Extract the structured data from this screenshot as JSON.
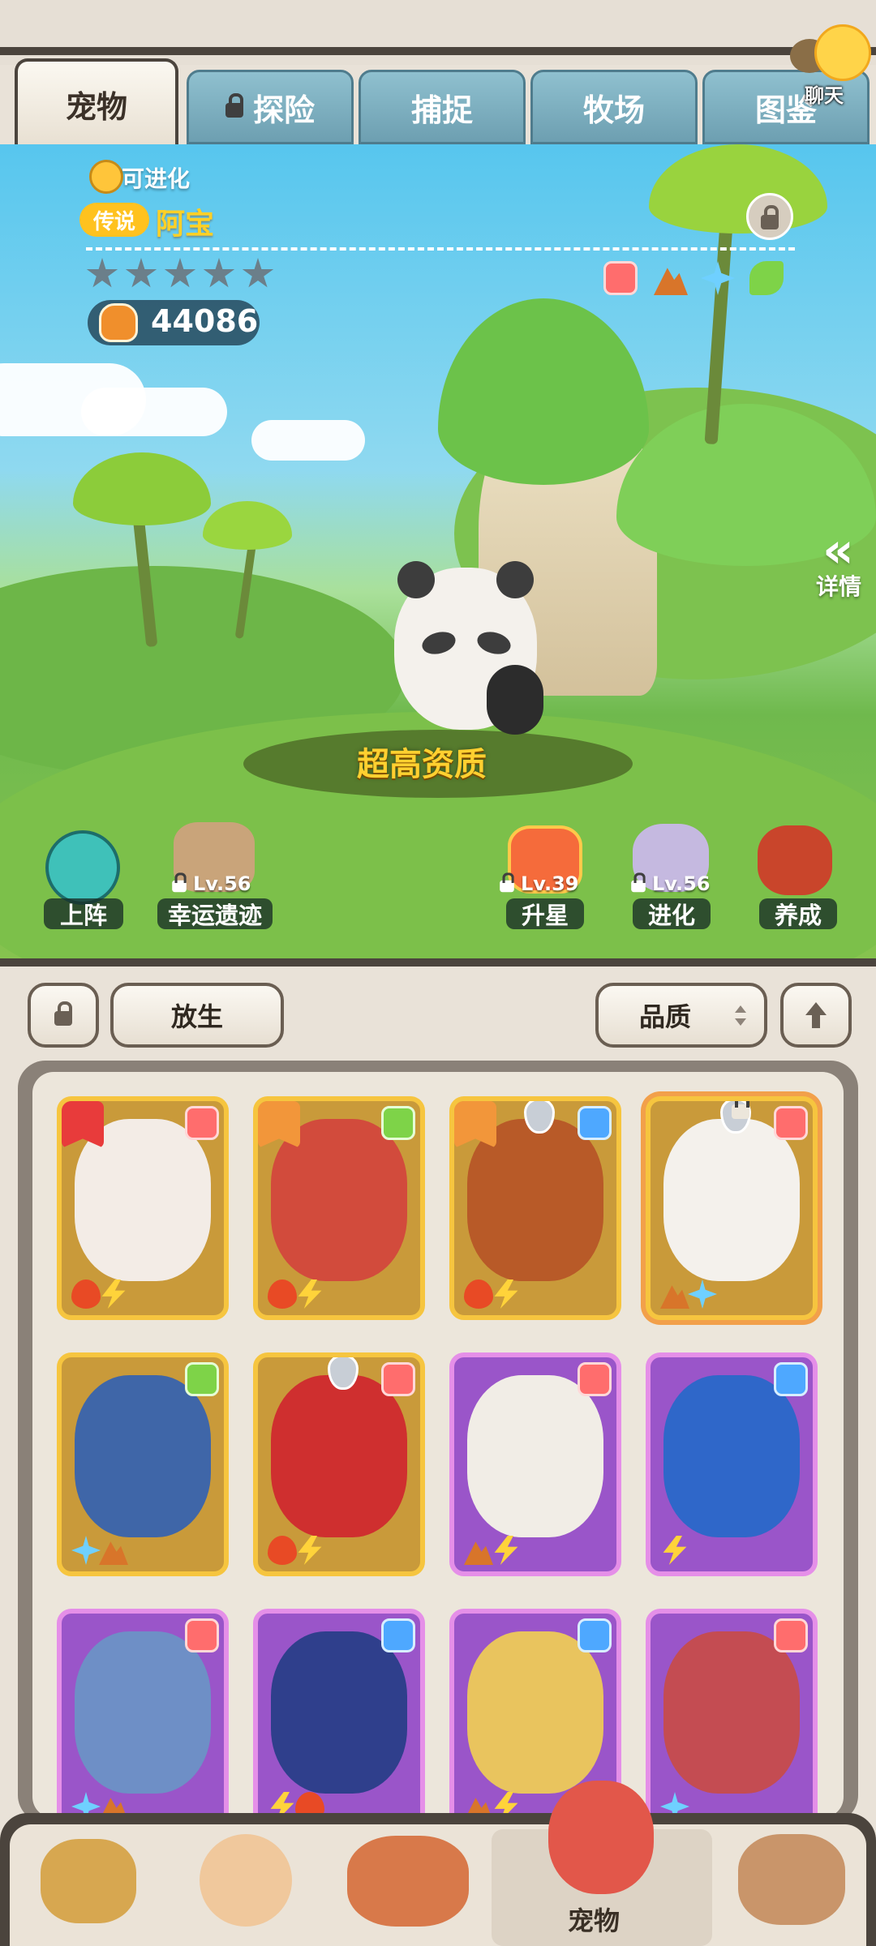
{
  "tabs": [
    {
      "label": "宠物",
      "active": true,
      "locked": false
    },
    {
      "label": "探险",
      "active": false,
      "locked": true
    },
    {
      "label": "捕捉",
      "active": false,
      "locked": false
    },
    {
      "label": "牧场",
      "active": false,
      "locked": false
    },
    {
      "label": "图鉴",
      "active": false,
      "locked": false
    }
  ],
  "chat": {
    "label": "聊天"
  },
  "pet": {
    "evolvable_text": "可进化",
    "rarity": "传说",
    "name": "阿宝",
    "stars_total": 5,
    "stars_filled": 0,
    "power": "44086",
    "quality_text": "超高资质",
    "traits": [
      "paw-red-icon",
      "earth-icon",
      "ice-icon",
      "leaf-icon"
    ]
  },
  "detail": {
    "arrow": "«",
    "label": "详情"
  },
  "actions": [
    {
      "label": "上阵",
      "level": "",
      "locked": false,
      "icon": "deploy-icon"
    },
    {
      "label": "幸运遗迹",
      "level": "Lv.56",
      "locked": true,
      "icon": "relic-icon"
    },
    {
      "label": "升星",
      "level": "Lv.39",
      "locked": true,
      "icon": "star-up-icon"
    },
    {
      "label": "进化",
      "level": "Lv.56",
      "locked": true,
      "icon": "evolve-icon"
    },
    {
      "label": "养成",
      "level": "",
      "locked": false,
      "icon": "nurture-icon"
    }
  ],
  "toolbar": {
    "release_label": "放生",
    "sort_label": "品质"
  },
  "pets_grid": [
    {
      "frame": "gold",
      "badge": "red",
      "corner": "red",
      "elements": [
        "fire",
        "bolt"
      ],
      "color": "#f3ece6"
    },
    {
      "frame": "gold",
      "badge": "green",
      "corner": "orange",
      "elements": [
        "fire",
        "bolt"
      ],
      "color": "#d24b3c"
    },
    {
      "frame": "gold",
      "badge": "blue",
      "corner": "orange",
      "shield": true,
      "elements": [
        "fire",
        "bolt"
      ],
      "color": "#b85a28"
    },
    {
      "frame": "gold",
      "badge": "red",
      "shield": true,
      "selected": true,
      "locked": true,
      "elements": [
        "earth",
        "ice"
      ],
      "color": "#f4f1ec"
    },
    {
      "frame": "gold",
      "badge": "green",
      "elements": [
        "ice",
        "earth"
      ],
      "color": "#3f66a8"
    },
    {
      "frame": "gold",
      "badge": "red",
      "shield": true,
      "elements": [
        "fire",
        "bolt"
      ],
      "color": "#cf2f2f"
    },
    {
      "frame": "purple",
      "badge": "red",
      "elements": [
        "earth",
        "bolt"
      ],
      "color": "#f1ede6"
    },
    {
      "frame": "purple",
      "badge": "blue",
      "elements": [
        "bolt"
      ],
      "color": "#2f67c9"
    },
    {
      "frame": "purple",
      "badge": "red",
      "elements": [
        "ice",
        "earth"
      ],
      "color": "#6e8fc6"
    },
    {
      "frame": "purple",
      "badge": "blue",
      "elements": [
        "bolt",
        "fire"
      ],
      "color": "#2f3f8c"
    },
    {
      "frame": "purple",
      "badge": "blue",
      "elements": [
        "earth",
        "bolt"
      ],
      "color": "#e9c45e"
    },
    {
      "frame": "purple",
      "badge": "red",
      "elements": [
        "ice"
      ],
      "color": "#c44c52"
    }
  ],
  "bottom_nav": [
    {
      "icon": "straw-hut-icon",
      "label": ""
    },
    {
      "icon": "trainer-icon",
      "label": ""
    },
    {
      "icon": "totem-icon",
      "label": ""
    },
    {
      "icon": "pet-dino-icon",
      "label": "宠物",
      "active": true
    },
    {
      "icon": "mask-house-icon",
      "label": ""
    }
  ],
  "colors": {
    "gold_frame": "#f6c53f",
    "purple_frame": "#e58fe8",
    "name_yellow": "#ffd027",
    "panel_dark": "#4b443d"
  }
}
